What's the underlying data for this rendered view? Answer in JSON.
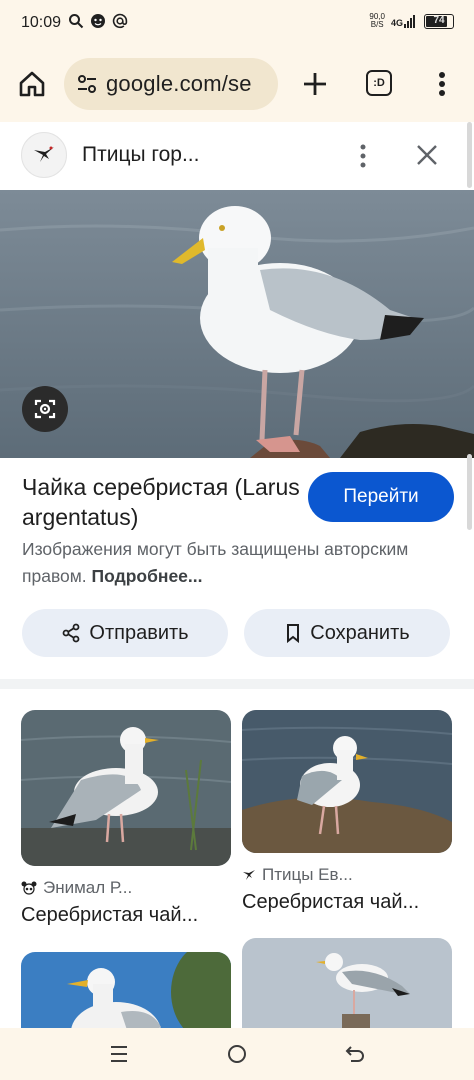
{
  "status_bar": {
    "time": "10:09",
    "net_speed_value": "90,0",
    "net_speed_unit": "B/S",
    "network": "4G",
    "battery": "74"
  },
  "browser": {
    "url": "google.com/se",
    "tab_label": ":D"
  },
  "panel": {
    "site_title": "Птицы гор...",
    "result_title": "Чайка серебристая (Larus argentatus)",
    "go_button": "Перейти",
    "copyright_text": "Изображения могут быть защищены авторским правом.",
    "copyright_more": "Подробнее...",
    "share_button": "Отправить",
    "save_button": "Сохранить"
  },
  "related": [
    {
      "source": "Энимал Р...",
      "title": "Серебристая чай..."
    },
    {
      "source": "Птицы Ев...",
      "title": "Серебристая чай..."
    },
    {
      "source": "",
      "title": ""
    },
    {
      "source": "",
      "title": ""
    }
  ],
  "colors": {
    "primary_button": "#0b57d0",
    "tonal_button": "#e9eef6",
    "chrome_background": "#fdf6ea"
  },
  "icons": [
    "search-icon",
    "face-icon",
    "at-icon",
    "home-icon",
    "site-settings-icon",
    "plus-icon",
    "more-vert-icon",
    "close-icon",
    "lens-icon",
    "share-icon",
    "bookmark-icon",
    "recents-icon",
    "home-circle-icon",
    "back-icon"
  ]
}
